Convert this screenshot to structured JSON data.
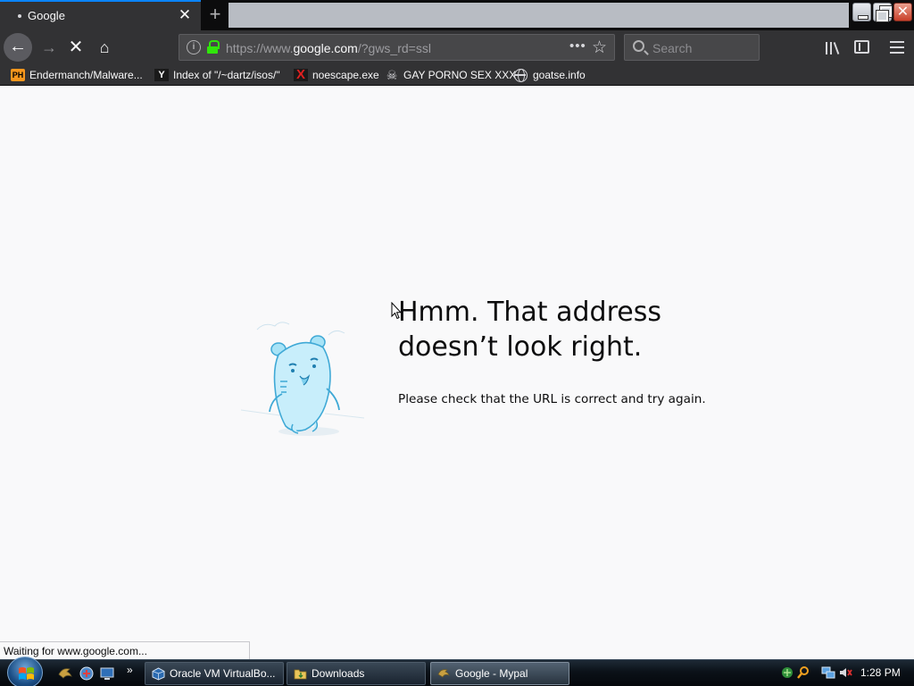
{
  "browser": {
    "tab": {
      "title": "Google",
      "close_glyph": "✕"
    },
    "new_tab_glyph": "+",
    "window_controls": {
      "close_glyph": "✕"
    },
    "nav": {
      "back_glyph": "←",
      "forward_glyph": "→",
      "stop_glyph": "✕",
      "home_glyph": "⌂"
    },
    "url": {
      "scheme": "https://www.",
      "host": "google.com",
      "path": "/?gws_rd=ssl",
      "info_glyph": "i",
      "page_actions_glyph": "•••",
      "star_glyph": "☆"
    },
    "search": {
      "placeholder": "Search"
    },
    "bookmarks": [
      {
        "label": "Endermanch/Malware...",
        "icon": "PH",
        "icon_name": "pornhub-favicon"
      },
      {
        "label": "Index of \"/~dartz/isos/\"",
        "icon": "Y",
        "icon_name": "ycombinator-favicon"
      },
      {
        "label": "noescape.exe",
        "icon": "X",
        "icon_name": "x-favicon"
      },
      {
        "label": "GAY PORNO SEX XXX",
        "icon": "☠",
        "icon_name": "skull-favicon"
      },
      {
        "label": "goatse.info",
        "icon": "",
        "icon_name": "globe-icon"
      }
    ]
  },
  "page": {
    "title": "Hmm. That address doesn’t look right.",
    "description": "Please check that the URL is correct and try again.",
    "status": "Waiting for www.google.com..."
  },
  "taskbar": {
    "more_glyph": "»",
    "tasks": [
      {
        "label": "Oracle VM VirtualBo...",
        "icon_name": "virtualbox-icon"
      },
      {
        "label": "Downloads",
        "icon_name": "folder-icon"
      },
      {
        "label": "Google - Mypal",
        "icon_name": "mypal-icon"
      }
    ],
    "clock": "1:28 PM"
  },
  "colors": {
    "accent": "#0a84ff",
    "toolbar": "#323234",
    "page_background": "#f9f9fa",
    "secure_lock": "#30e60b"
  }
}
